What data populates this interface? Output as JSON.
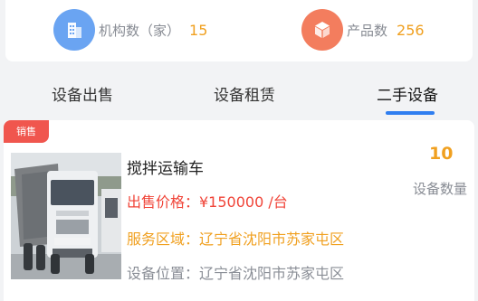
{
  "stats": {
    "orgs": {
      "label": "机构数（家）",
      "value": "15",
      "icon": "building-icon",
      "color": "#6aa4f2"
    },
    "products": {
      "label": "产品数",
      "value": "256",
      "icon": "box-icon",
      "color": "#f37d5e"
    }
  },
  "tabs": {
    "items": [
      "设备出售",
      "设备租赁",
      "二手设备"
    ],
    "active": "二手设备",
    "accent": "#2f7ef0"
  },
  "listing": {
    "badge": "销售",
    "title": "搅拌运输车",
    "price": "出售价格：¥150000 /台",
    "service_area": "服务区域：辽宁省沈阳市苏家屯区",
    "location": "设备位置：辽宁省沈阳市苏家屯区",
    "count": "10",
    "count_label": "设备数量",
    "photo": "truck-photo"
  }
}
